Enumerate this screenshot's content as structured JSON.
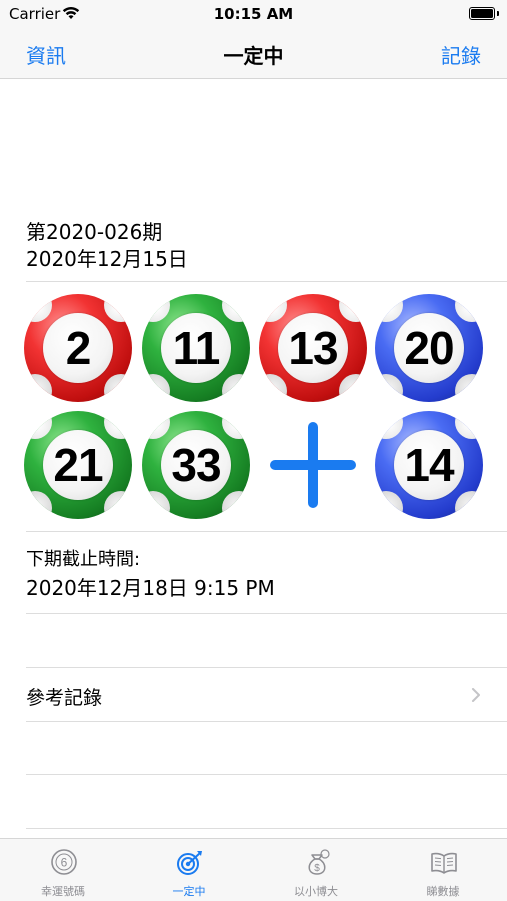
{
  "status_bar": {
    "carrier": "Carrier",
    "time": "10:15 AM"
  },
  "nav": {
    "left_label": "資訊",
    "title": "一定中",
    "right_label": "記錄"
  },
  "draw": {
    "period": "第2020-026期",
    "date": "2020年12月15日",
    "numbers": [
      {
        "value": "2",
        "color": "red"
      },
      {
        "value": "11",
        "color": "green"
      },
      {
        "value": "13",
        "color": "red"
      },
      {
        "value": "20",
        "color": "blue"
      },
      {
        "value": "21",
        "color": "green"
      },
      {
        "value": "33",
        "color": "green"
      }
    ],
    "special": {
      "value": "14",
      "color": "blue"
    },
    "plus_icon": "plus-icon"
  },
  "deadline": {
    "label": "下期截止時間:",
    "value": "2020年12月18日 9:15 PM"
  },
  "reference": {
    "label": "參考記錄",
    "icon": "chevron-right-icon"
  },
  "tabs": [
    {
      "label": "幸運號碼",
      "icon": "lucky-number-icon",
      "active": false
    },
    {
      "label": "一定中",
      "icon": "target-icon",
      "active": true
    },
    {
      "label": "以小博大",
      "icon": "money-bag-icon",
      "active": false
    },
    {
      "label": "睇數據",
      "icon": "book-icon",
      "active": false
    }
  ],
  "colors": {
    "accent": "#1a7bf0",
    "inactive_tab": "#8e8e93",
    "ball_red": "#e02020",
    "ball_green": "#22a033",
    "ball_blue": "#3552e6"
  }
}
